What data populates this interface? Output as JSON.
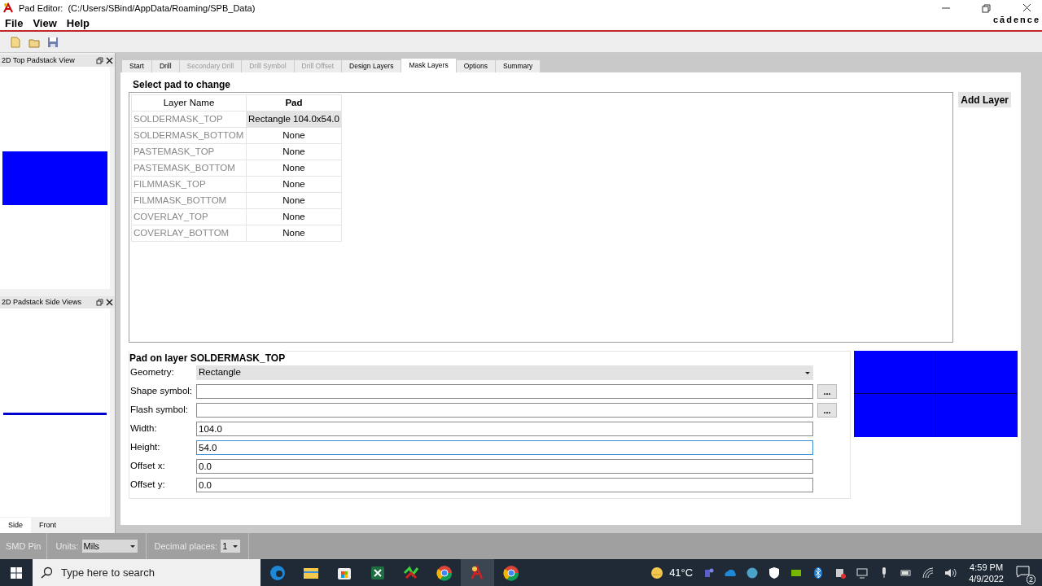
{
  "window": {
    "title": "Pad Editor:",
    "path": "(C:/Users/SBind/AppData/Roaming/SPB_Data)",
    "brand": "cādence"
  },
  "menu": [
    "File",
    "View",
    "Help"
  ],
  "left_panels": [
    {
      "title": "2D Top Padstack View",
      "kind": "top"
    },
    {
      "title": "2D Padstack Side Views",
      "kind": "side"
    }
  ],
  "view_tabs": [
    {
      "label": "Side",
      "selected": true
    },
    {
      "label": "Front",
      "selected": false
    }
  ],
  "tabs": [
    {
      "label": "Start",
      "selected": false,
      "disabled": false
    },
    {
      "label": "Drill",
      "selected": false,
      "disabled": false
    },
    {
      "label": "Secondary Drill",
      "selected": false,
      "disabled": true
    },
    {
      "label": "Drill Symbol",
      "selected": false,
      "disabled": true
    },
    {
      "label": "Drill Offset",
      "selected": false,
      "disabled": true
    },
    {
      "label": "Design Layers",
      "selected": false,
      "disabled": false
    },
    {
      "label": "Mask Layers",
      "selected": true,
      "disabled": false
    },
    {
      "label": "Options",
      "selected": false,
      "disabled": false
    },
    {
      "label": "Summary",
      "selected": false,
      "disabled": false
    }
  ],
  "section_title": "Select pad to change",
  "table": {
    "columns": [
      "Layer Name",
      "Pad"
    ],
    "rows": [
      {
        "layer": "SOLDERMASK_TOP",
        "pad": "Rectangle 104.0x54.0",
        "selected": true
      },
      {
        "layer": "SOLDERMASK_BOTTOM",
        "pad": "None",
        "selected": false
      },
      {
        "layer": "PASTEMASK_TOP",
        "pad": "None",
        "selected": false
      },
      {
        "layer": "PASTEMASK_BOTTOM",
        "pad": "None",
        "selected": false
      },
      {
        "layer": "FILMMASK_TOP",
        "pad": "None",
        "selected": false
      },
      {
        "layer": "FILMMASK_BOTTOM",
        "pad": "None",
        "selected": false
      },
      {
        "layer": "COVERLAY_TOP",
        "pad": "None",
        "selected": false
      },
      {
        "layer": "COVERLAY_BOTTOM",
        "pad": "None",
        "selected": false
      }
    ]
  },
  "add_layer_button": "Add Layer",
  "pad_section": {
    "title": "Pad on layer SOLDERMASK_TOP",
    "fields": [
      {
        "label": "Geometry:",
        "kind": "select",
        "value": "Rectangle",
        "focused": false
      },
      {
        "label": "Shape symbol:",
        "kind": "browse",
        "browse": "...",
        "focused": false
      },
      {
        "label": "Flash symbol:",
        "kind": "browse",
        "browse": "...",
        "focused": false
      },
      {
        "label": "Width:",
        "kind": "text",
        "value": "104.0",
        "focused": false
      },
      {
        "label": "Height:",
        "kind": "text",
        "value": "54.0",
        "focused": true
      },
      {
        "label": "Offset x:",
        "kind": "text",
        "value": "0.0",
        "focused": false
      },
      {
        "label": "Offset y:",
        "kind": "text",
        "value": "0.0",
        "focused": false
      }
    ]
  },
  "status_bar": {
    "mode": "SMD Pin",
    "units_label": "Units:",
    "units": "Mils",
    "decimal_label": "Decimal places:",
    "decimal": "1"
  },
  "taskbar": {
    "search_placeholder": "Type here to search",
    "temperature": "41°C",
    "time": "4:59 PM",
    "date": "4/9/2022",
    "notifications": "2"
  }
}
